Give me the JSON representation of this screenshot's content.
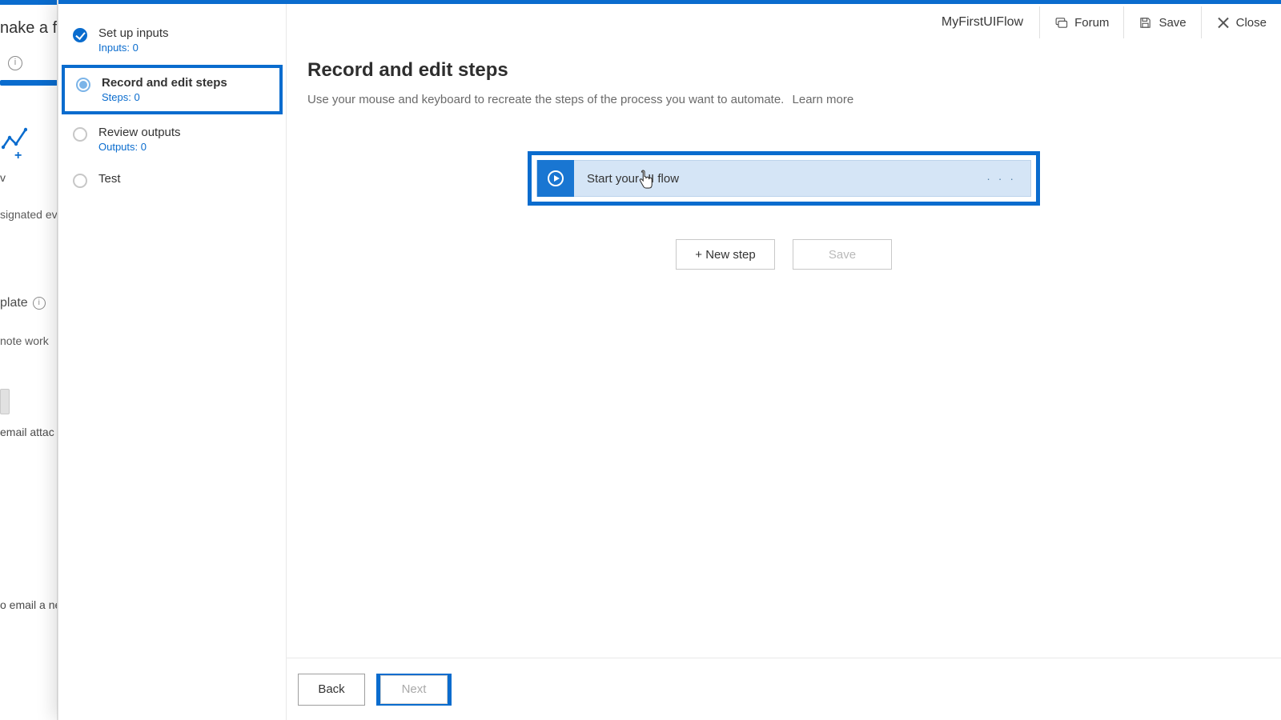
{
  "background": {
    "heading": "nake a flo",
    "trigger_text": "v",
    "trigger_sub": "signated even",
    "template_label": "plate",
    "template_sub": "note work",
    "attach_text": " email attac",
    "email_text": "o email a ne"
  },
  "header": {
    "flow_name": "MyFirstUIFlow",
    "forum": "Forum",
    "save": "Save",
    "close": "Close"
  },
  "steps": [
    {
      "title": "Set up inputs",
      "sub": "Inputs: 0",
      "state": "done"
    },
    {
      "title": "Record and edit steps",
      "sub": "Steps: 0",
      "state": "active"
    },
    {
      "title": "Review outputs",
      "sub": "Outputs: 0",
      "state": "pending"
    },
    {
      "title": "Test",
      "sub": "",
      "state": "pending"
    }
  ],
  "main": {
    "heading": "Record and edit steps",
    "description": "Use your mouse and keyboard to recreate the steps of the process you want to automate.",
    "learn_more": "Learn more",
    "flow_card_label": "Start your UI flow",
    "flow_card_menu": "· · ·",
    "new_step": "+ New step",
    "save": "Save"
  },
  "footer": {
    "back": "Back",
    "next": "Next"
  }
}
